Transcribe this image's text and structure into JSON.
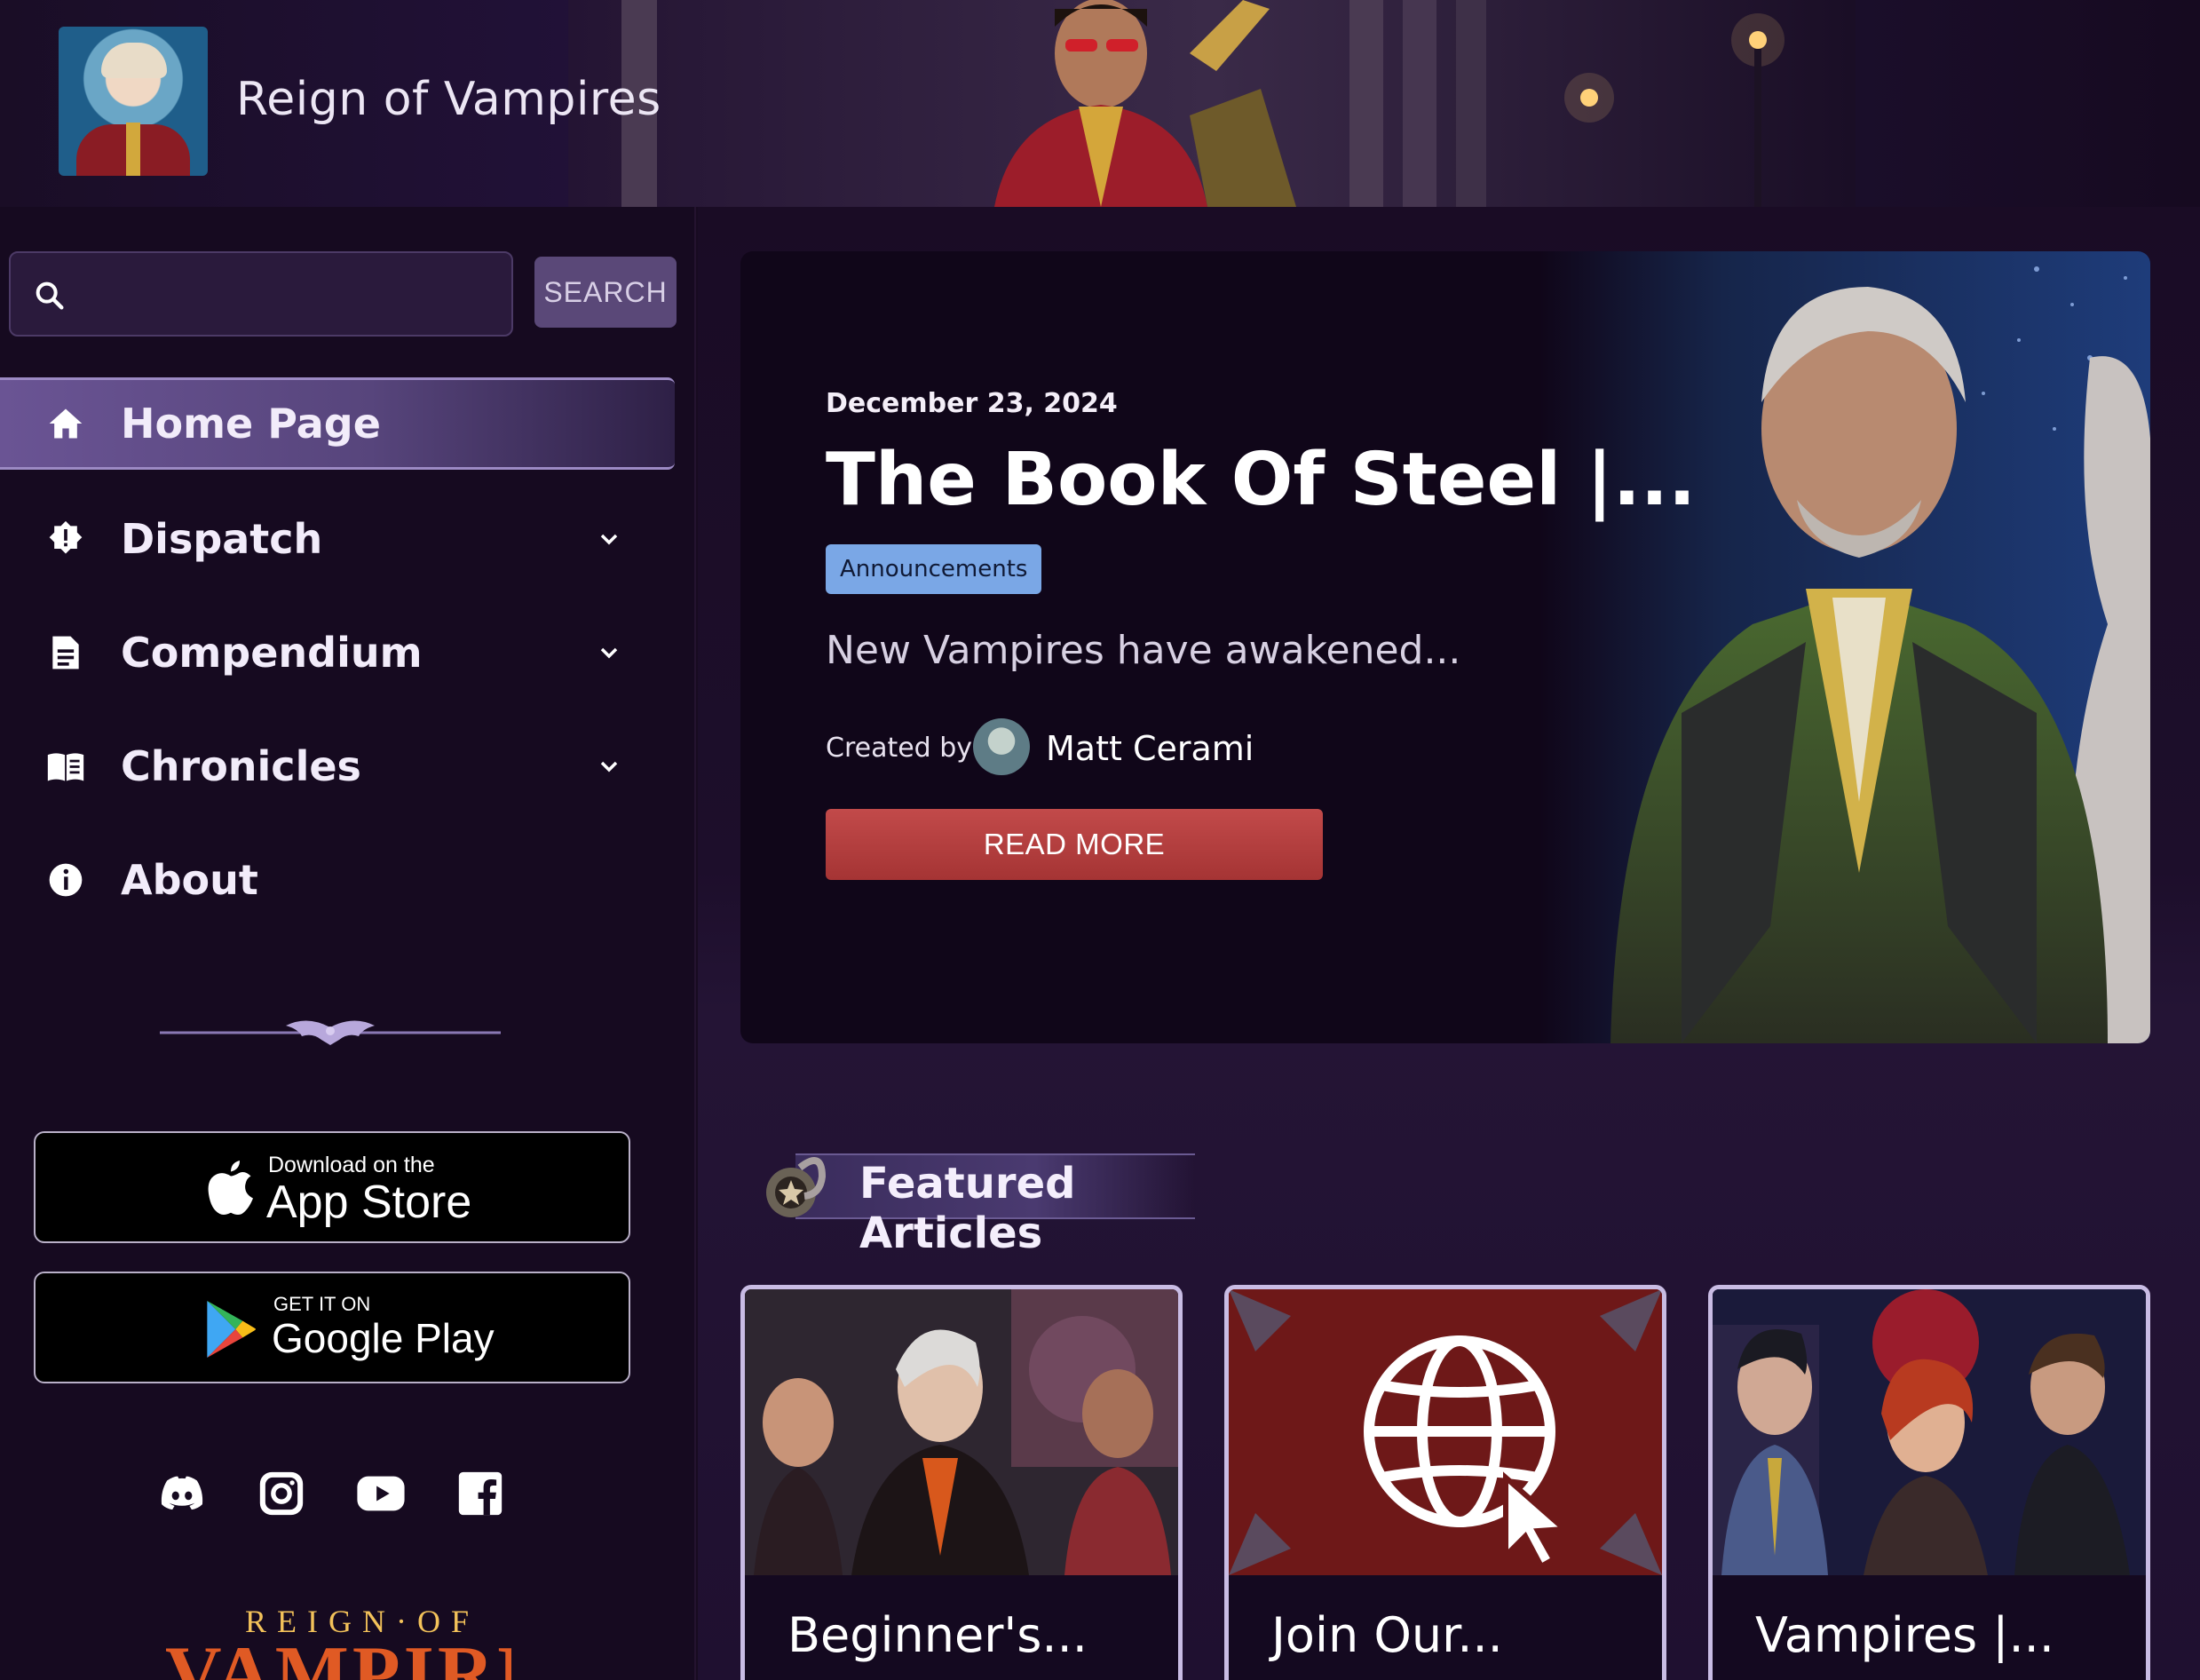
{
  "header": {
    "site_title": "Reign of Vampires"
  },
  "search": {
    "placeholder": "",
    "value": "",
    "button_label": "SEARCH"
  },
  "nav": {
    "items": [
      {
        "label": "Home Page",
        "icon": "home-icon",
        "active": true,
        "expandable": false
      },
      {
        "label": "Dispatch",
        "icon": "alert-badge-icon",
        "active": false,
        "expandable": true
      },
      {
        "label": "Compendium",
        "icon": "document-icon",
        "active": false,
        "expandable": true
      },
      {
        "label": "Chronicles",
        "icon": "open-book-icon",
        "active": false,
        "expandable": true
      },
      {
        "label": "About",
        "icon": "info-icon",
        "active": false,
        "expandable": false
      }
    ]
  },
  "stores": {
    "apple": {
      "small": "Download on the",
      "big": "App Store"
    },
    "google": {
      "small": "GET IT ON",
      "big": "Google Play"
    }
  },
  "social": [
    "discord-icon",
    "instagram-icon",
    "youtube-icon",
    "facebook-icon"
  ],
  "bottom_logo": {
    "top": "REIGN·OF",
    "main": "VAMPIRES"
  },
  "hero": {
    "date": "December 23, 2024",
    "title": "The Book Of Steel |...",
    "tag": "Announcements",
    "excerpt": "New Vampires have awakened...",
    "created_by_label": "Created by",
    "author": "Matt Cerami",
    "button_label": "READ MORE"
  },
  "featured": {
    "heading": "Featured Articles",
    "cards": [
      {
        "title": "Beginner's..."
      },
      {
        "title": "Join Our..."
      },
      {
        "title": "Vampires |..."
      }
    ]
  },
  "colors": {
    "background": "#180b21",
    "nav_active": "#57457c",
    "tag": "#7aa7e6",
    "read_more": "#b03c3c",
    "card_border": "#c9bce4"
  }
}
